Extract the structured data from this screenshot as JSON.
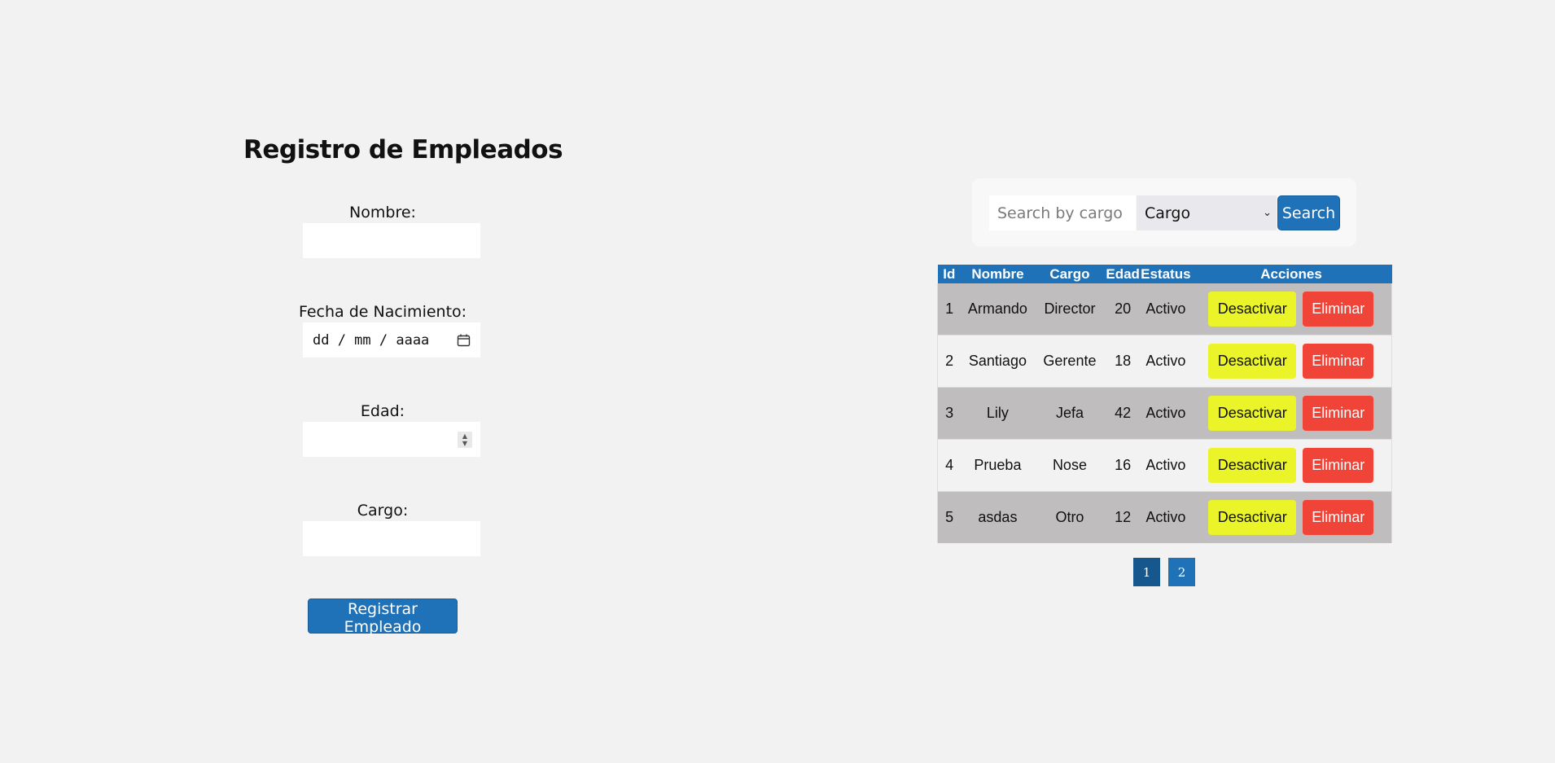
{
  "form": {
    "title": "Registro de Empleados",
    "nombre_label": "Nombre:",
    "nombre_value": "",
    "fecha_label": "Fecha de Nacimiento:",
    "fecha_placeholder": "dd / mm / aaaa",
    "edad_label": "Edad:",
    "edad_value": "",
    "cargo_label": "Cargo:",
    "cargo_value": "",
    "submit_label": "Registrar Empleado"
  },
  "search": {
    "placeholder": "Search by cargo",
    "select_value": "Cargo",
    "button_label": "Search"
  },
  "table": {
    "headers": [
      "Id",
      "Nombre",
      "Cargo",
      "Edad",
      "Estatus",
      "Acciones"
    ],
    "rows": [
      {
        "id": "1",
        "nombre": "Armando",
        "cargo": "Director",
        "edad": "20",
        "estatus": "Activo",
        "deactivate": "Desactivar",
        "delete": "Eliminar"
      },
      {
        "id": "2",
        "nombre": "Santiago",
        "cargo": "Gerente",
        "edad": "18",
        "estatus": "Activo",
        "deactivate": "Desactivar",
        "delete": "Eliminar"
      },
      {
        "id": "3",
        "nombre": "Lily",
        "cargo": "Jefa",
        "edad": "42",
        "estatus": "Activo",
        "deactivate": "Desactivar",
        "delete": "Eliminar"
      },
      {
        "id": "4",
        "nombre": "Prueba",
        "cargo": "Nose",
        "edad": "16",
        "estatus": "Activo",
        "deactivate": "Desactivar",
        "delete": "Eliminar"
      },
      {
        "id": "5",
        "nombre": "asdas",
        "cargo": "Otro",
        "edad": "12",
        "estatus": "Activo",
        "deactivate": "Desactivar",
        "delete": "Eliminar"
      }
    ]
  },
  "pagination": {
    "pages": [
      "1",
      "2"
    ],
    "current": "1"
  },
  "colors": {
    "primary": "#1f72b8",
    "page_active": "#16578e",
    "deactivate": "#eaf429",
    "delete": "#f04439",
    "row_odd": "#bfbdbd",
    "background": "#f2f2f2"
  },
  "icons": {
    "date": "calendar-icon",
    "select": "chevron-down-icon",
    "number": "spinner-icon"
  }
}
